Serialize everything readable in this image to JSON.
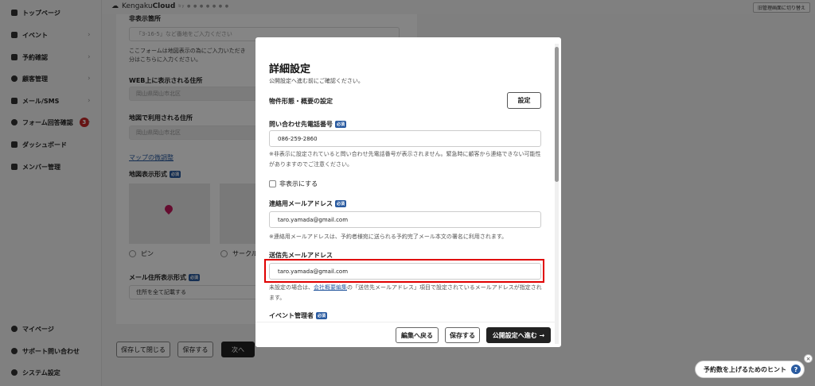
{
  "sidebar": {
    "items": [
      {
        "label": "トップページ",
        "icon": "home-icon"
      },
      {
        "label": "イベント",
        "icon": "document-icon"
      },
      {
        "label": "予約確認",
        "icon": "calendar-icon"
      },
      {
        "label": "顧客管理",
        "icon": "users-icon"
      },
      {
        "label": "メール/SMS",
        "icon": "mail-icon"
      },
      {
        "label": "フォーム回答確認",
        "icon": "chat-icon",
        "badge": "3"
      },
      {
        "label": "ダッシュボード",
        "icon": "chart-icon"
      },
      {
        "label": "メンバー管理",
        "icon": "grid-icon"
      }
    ],
    "bottom_items": [
      {
        "label": "マイページ",
        "icon": "person-icon"
      },
      {
        "label": "サポート問い合わせ",
        "icon": "help-icon"
      },
      {
        "label": "システム設定",
        "icon": "gear-icon"
      }
    ]
  },
  "header": {
    "logo_prefix": "Kengaku",
    "logo_bold": "Cloud",
    "logo_tag": "by ● ● ● ● ● ● ●",
    "switch_button": "旧管理画面に切り替え"
  },
  "background_form": {
    "hidden_section_title": "非表示箇所",
    "hidden_placeholder": "「3-16-5」など番地をご入力ください",
    "note_line1": "ここフォームは地図表示の為にご入力いただき",
    "note_line2": "分はこちらに入力ください。",
    "web_address_title": "WEB上に表示される住所",
    "web_address_placeholder": "岡山県岡山市北区",
    "map_address_title": "地図で利用される住所",
    "map_address_placeholder": "岡山県岡山市北区",
    "map_adjust_link": "マップの微調整",
    "map_display_title": "地図表示形式",
    "required": "必須",
    "radio_pin": "ピン",
    "radio_circle": "サークル",
    "mail_format_title": "メール住所表示形式",
    "mail_format_value": "住所を全て記載する",
    "save_close": "保存して閉じる",
    "save": "保存する",
    "next": "次へ"
  },
  "modal": {
    "title": "詳細設定",
    "subtitle": "公開設定へ進む前にご確認ください。",
    "property_label": "物件形態・概要の設定",
    "property_button": "設定",
    "phone_label": "問い合わせ先電話番号",
    "phone_value": "086-259-2860",
    "phone_note": "※非表示に設定されていると問い合わせ先電話番号が表示されません。緊急時に顧客から連絡できない可能性がありますのでご注意ください。",
    "hide_checkbox": "非表示にする",
    "contact_email_label": "連絡用メールアドレス",
    "contact_email_value": "taro.yamada@gmail.com",
    "contact_email_note": "※連絡用メールアドレスは、予約者様宛に送られる予約完了メール本文の署名に利用されます。",
    "send_email_label": "送信先メールアドレス",
    "send_email_value": "taro.yamada@gmail.com",
    "send_note_prefix": "未設定の場合は、",
    "send_note_link": "会社概要編集",
    "send_note_suffix": "の「送信先メールアドレス」項目で設定されているメールアドレスが指定されます。",
    "event_manager_label": "イベント管理者",
    "required": "必須",
    "back_button": "編集へ戻る",
    "save_button": "保存する",
    "publish_button": "公開設定へ進む →"
  },
  "hint": {
    "label": "予約数を上げるためのヒント",
    "help": "?",
    "close": "×"
  },
  "colors": {
    "accent": "#2a5ba0",
    "highlight": "#e00000",
    "dark_button": "#222222"
  }
}
